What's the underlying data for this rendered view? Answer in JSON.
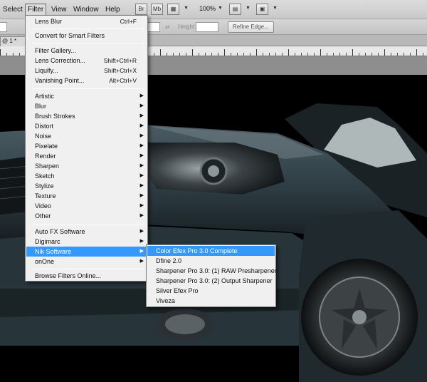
{
  "menubar": {
    "items": [
      "Select",
      "Filter",
      "View",
      "Window",
      "Help"
    ],
    "zoom": "100%"
  },
  "options": {
    "height_label": "Height:",
    "refine_edge": "Refine Edge..."
  },
  "tab": {
    "label": "@ 1 *"
  },
  "filter_menu": {
    "items": [
      {
        "label": "Lens Blur",
        "shortcut": "Ctrl+F"
      },
      {
        "label": "Convert for Smart Filters"
      },
      {
        "label": "Filter Gallery..."
      },
      {
        "label": "Lens Correction...",
        "shortcut": "Shift+Ctrl+R"
      },
      {
        "label": "Liquify...",
        "shortcut": "Shift+Ctrl+X"
      },
      {
        "label": "Vanishing Point...",
        "shortcut": "Alt+Ctrl+V"
      },
      {
        "label": "Artistic"
      },
      {
        "label": "Blur"
      },
      {
        "label": "Brush Strokes"
      },
      {
        "label": "Distort"
      },
      {
        "label": "Noise"
      },
      {
        "label": "Pixelate"
      },
      {
        "label": "Render"
      },
      {
        "label": "Sharpen"
      },
      {
        "label": "Sketch"
      },
      {
        "label": "Stylize"
      },
      {
        "label": "Texture"
      },
      {
        "label": "Video"
      },
      {
        "label": "Other"
      },
      {
        "label": "Auto FX Software"
      },
      {
        "label": "Digimarc"
      },
      {
        "label": "Nik Software"
      },
      {
        "label": "onOne"
      },
      {
        "label": "Browse Filters Online..."
      }
    ]
  },
  "nik_submenu": {
    "items": [
      "Color Efex Pro 3.0 Complete",
      "Dfine 2.0",
      "Sharpener Pro 3.0: (1) RAW Presharpener",
      "Sharpener Pro 3.0: (2) Output Sharpener",
      "Silver Efex Pro",
      "Viveza"
    ]
  },
  "colors": {
    "highlight": "#3399ff",
    "menu_bg": "#f0f0f0",
    "car_body": "#2f3e45"
  }
}
